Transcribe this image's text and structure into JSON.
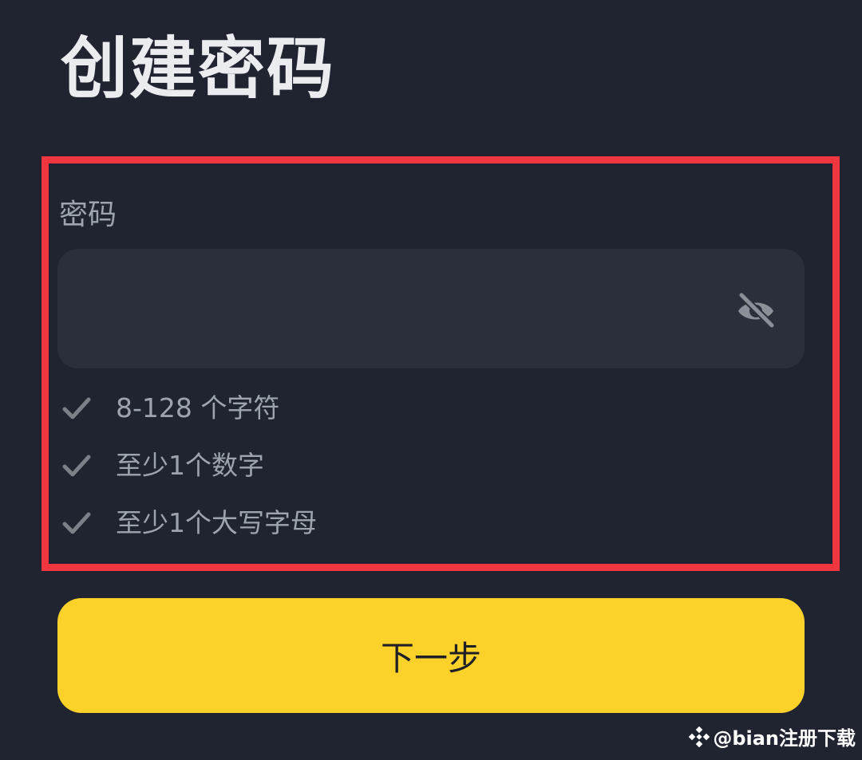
{
  "page": {
    "title": "创建密码"
  },
  "password": {
    "label": "密码",
    "value": "",
    "placeholder": "",
    "visibility_icon": "eye-off-icon"
  },
  "requirements": [
    {
      "icon": "check-icon",
      "text": "8-128 个字符"
    },
    {
      "icon": "check-icon",
      "text": "至少1个数字"
    },
    {
      "icon": "check-icon",
      "text": "至少1个大写字母"
    }
  ],
  "actions": {
    "next_label": "下一步"
  },
  "watermark": {
    "text": "@bian注册下载",
    "icon": "binance-logo-icon"
  },
  "colors": {
    "background": "#1f2430",
    "field_background": "#2a2f3b",
    "highlight_border": "#f0363f",
    "primary_button": "#fcd12a",
    "muted_text": "#9ea4ad",
    "title_text": "#eaecef"
  }
}
